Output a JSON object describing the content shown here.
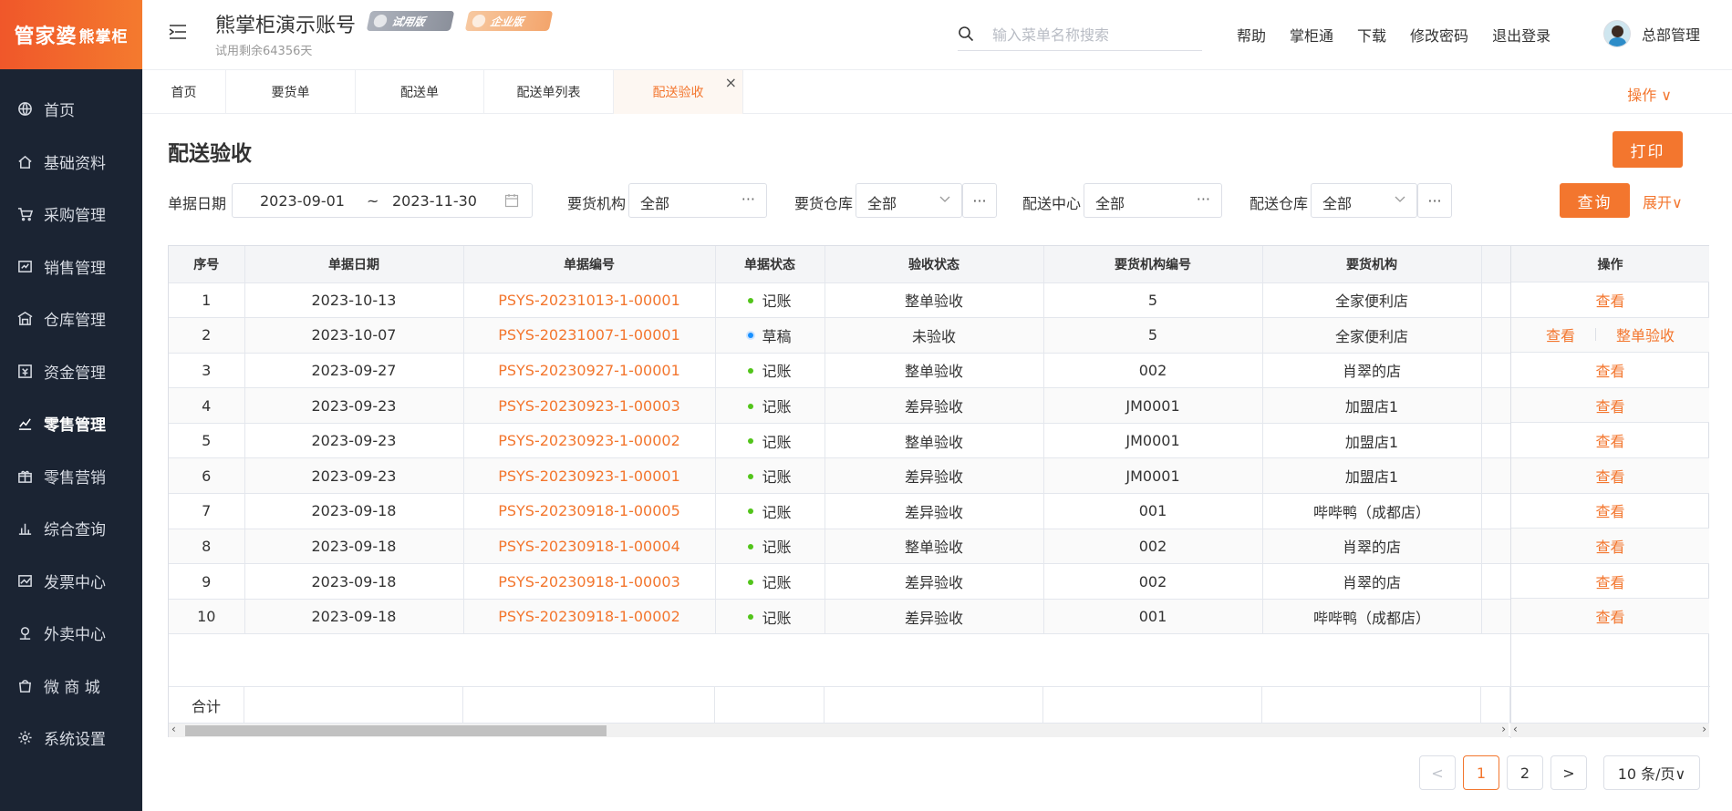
{
  "logo": {
    "main": "管家婆",
    "small": "熊掌柜"
  },
  "sidebar": {
    "items": [
      {
        "label": "首页",
        "icon": "globe-icon"
      },
      {
        "label": "基础资料",
        "icon": "home-icon"
      },
      {
        "label": "采购管理",
        "icon": "cart-icon"
      },
      {
        "label": "销售管理",
        "icon": "sales-icon"
      },
      {
        "label": "仓库管理",
        "icon": "warehouse-icon"
      },
      {
        "label": "资金管理",
        "icon": "finance-icon"
      },
      {
        "label": "零售管理",
        "icon": "chart-icon"
      },
      {
        "label": "零售营销",
        "icon": "gift-icon"
      },
      {
        "label": "综合查询",
        "icon": "bar-chart-icon"
      },
      {
        "label": "发票中心",
        "icon": "line-chart-icon"
      },
      {
        "label": "外卖中心",
        "icon": "delivery-icon"
      },
      {
        "label": "微 商 城",
        "icon": "shop-icon"
      },
      {
        "label": "系统设置",
        "icon": "gear-icon"
      }
    ],
    "active_index": 6
  },
  "header": {
    "account_name": "熊掌柜演示账号",
    "trial_text": "试用剩余64356天",
    "badge_trial": "试用版",
    "badge_enterprise": "企业版",
    "search_placeholder": "输入菜单名称搜索",
    "links": [
      "帮助",
      "掌柜通",
      "下载",
      "修改密码",
      "退出登录"
    ],
    "user_name": "总部管理"
  },
  "tabs": {
    "items": [
      "首页",
      "要货单",
      "配送单",
      "配送单列表",
      "配送验收"
    ],
    "active_index": 4,
    "ops_label": "操作 ∨"
  },
  "page": {
    "title": "配送验收",
    "print_label": "打印",
    "filters": {
      "date_label": "单据日期",
      "date_start": "2023-09-01",
      "date_sep": "~",
      "date_end": "2023-11-30",
      "org_label": "要货机构",
      "org_value": "全部",
      "wh_label": "要货仓库",
      "wh_value": "全部",
      "center_label": "配送中心",
      "center_value": "全部",
      "dwh_label": "配送仓库",
      "dwh_value": "全部",
      "query_label": "查询",
      "expand_label": "展开∨"
    }
  },
  "table": {
    "headers": [
      "序号",
      "单据日期",
      "单据编号",
      "单据状态",
      "验收状态",
      "要货机构编号",
      "要货机构",
      "",
      "操作"
    ],
    "rows": [
      {
        "no": "1",
        "date": "2023-10-13",
        "code": "PSYS-20231013-1-00001",
        "status": "记账",
        "status_color": "#52c41a",
        "check": "整单验收",
        "org_code": "5",
        "org": "全家便利店",
        "ops": [
          "查看"
        ]
      },
      {
        "no": "2",
        "date": "2023-10-07",
        "code": "PSYS-20231007-1-00001",
        "status": "草稿",
        "status_color": "#1890ff",
        "check": "未验收",
        "org_code": "5",
        "org": "全家便利店",
        "ops": [
          "查看",
          "整单验收"
        ]
      },
      {
        "no": "3",
        "date": "2023-09-27",
        "code": "PSYS-20230927-1-00001",
        "status": "记账",
        "status_color": "#52c41a",
        "check": "整单验收",
        "org_code": "002",
        "org": "肖翠的店",
        "ops": [
          "查看"
        ]
      },
      {
        "no": "4",
        "date": "2023-09-23",
        "code": "PSYS-20230923-1-00003",
        "status": "记账",
        "status_color": "#52c41a",
        "check": "差异验收",
        "org_code": "JM0001",
        "org": "加盟店1",
        "ops": [
          "查看"
        ]
      },
      {
        "no": "5",
        "date": "2023-09-23",
        "code": "PSYS-20230923-1-00002",
        "status": "记账",
        "status_color": "#52c41a",
        "check": "整单验收",
        "org_code": "JM0001",
        "org": "加盟店1",
        "ops": [
          "查看"
        ]
      },
      {
        "no": "6",
        "date": "2023-09-23",
        "code": "PSYS-20230923-1-00001",
        "status": "记账",
        "status_color": "#52c41a",
        "check": "差异验收",
        "org_code": "JM0001",
        "org": "加盟店1",
        "ops": [
          "查看"
        ]
      },
      {
        "no": "7",
        "date": "2023-09-18",
        "code": "PSYS-20230918-1-00005",
        "status": "记账",
        "status_color": "#52c41a",
        "check": "差异验收",
        "org_code": "001",
        "org": "哔哔鸭（成都店）",
        "ops": [
          "查看"
        ]
      },
      {
        "no": "8",
        "date": "2023-09-18",
        "code": "PSYS-20230918-1-00004",
        "status": "记账",
        "status_color": "#52c41a",
        "check": "整单验收",
        "org_code": "002",
        "org": "肖翠的店",
        "ops": [
          "查看"
        ]
      },
      {
        "no": "9",
        "date": "2023-09-18",
        "code": "PSYS-20230918-1-00003",
        "status": "记账",
        "status_color": "#52c41a",
        "check": "差异验收",
        "org_code": "002",
        "org": "肖翠的店",
        "ops": [
          "查看"
        ]
      },
      {
        "no": "10",
        "date": "2023-09-18",
        "code": "PSYS-20230918-1-00002",
        "status": "记账",
        "status_color": "#52c41a",
        "check": "差异验收",
        "org_code": "001",
        "org": "哔哔鸭（成都店）",
        "ops": [
          "查看"
        ]
      }
    ],
    "total_label": "合计"
  },
  "pagination": {
    "prev": "<",
    "pages": [
      "1",
      "2"
    ],
    "current": "1",
    "next": ">",
    "page_size": "10 条/页∨"
  },
  "colors": {
    "accent": "#f3762e",
    "sidebar_bg": "#1b2433"
  }
}
